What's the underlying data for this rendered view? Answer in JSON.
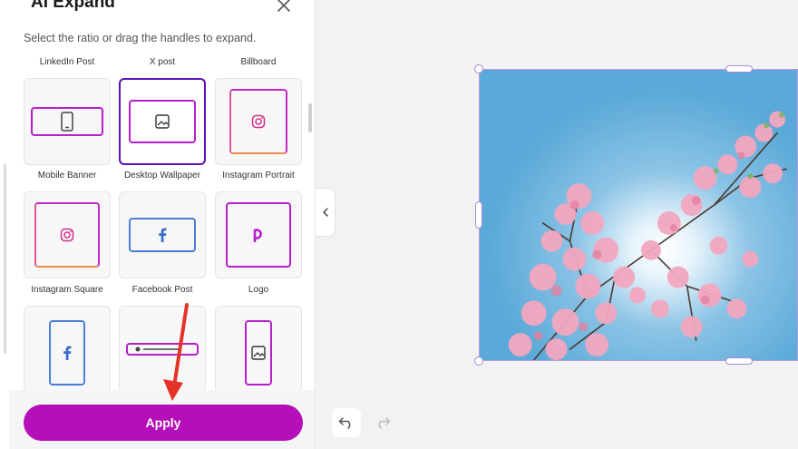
{
  "panel": {
    "title": "AI Expand",
    "subtitle": "Select the ratio or drag the handles to expand.",
    "close_icon": "close-icon"
  },
  "top_labels": [
    "LinkedIn Post",
    "X post",
    "Billboard"
  ],
  "tiles": [
    {
      "label": "Mobile Banner",
      "icon": "phone-icon",
      "selected": false
    },
    {
      "label": "Desktop Wallpaper",
      "icon": "image-icon",
      "selected": true
    },
    {
      "label": "Instagram Portrait",
      "icon": "instagram-icon",
      "selected": false
    },
    {
      "label": "Instagram Square",
      "icon": "instagram-icon",
      "selected": false
    },
    {
      "label": "Facebook Post",
      "icon": "facebook-icon",
      "selected": false
    },
    {
      "label": "Logo",
      "icon": "p-logo-icon",
      "selected": false
    },
    {
      "label": "",
      "icon": "facebook-icon",
      "selected": false
    },
    {
      "label": "",
      "icon": "banner-bar-icon",
      "selected": false
    },
    {
      "label": "",
      "icon": "image-icon",
      "selected": false
    }
  ],
  "footer": {
    "apply_label": "Apply"
  },
  "colors": {
    "accent": "#b40fb8",
    "selected_border": "#5b0fb8",
    "facebook_blue": "#4a7fd9",
    "handle_border": "#a88ad8",
    "sky": "#6fb3dc",
    "blossom": "#f2a9c2"
  }
}
